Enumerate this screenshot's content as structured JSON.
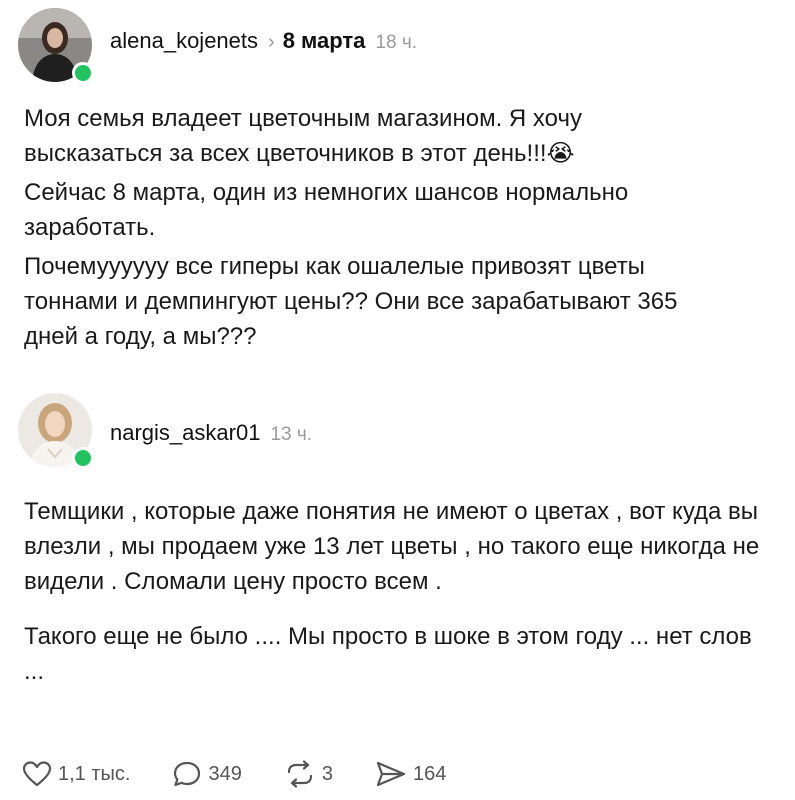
{
  "post": {
    "author": "alena_kojenets",
    "topic": "8 марта",
    "time": "18 ч.",
    "paragraphs": [
      "Моя семья владеет цветочным магазином. Я хочу высказаться за всех цветочников в этот день!!!😭",
      "Сейчас 8 марта, один из немногих шансов нормально заработать.",
      "Почемуууууу все гиперы как ошалелые привозят цветы тоннами и демпингуют цены?? Они все зарабатывают 365 дней а году, а мы???"
    ]
  },
  "reply": {
    "author": "nargis_askar01",
    "time": "13 ч.",
    "paragraphs": [
      "Темщики , которые даже понятия не имеют о цветах , вот куда вы влезли , мы продаем уже 13 лет цветы , но такого еще никогда не видели . Сломали цену просто всем .",
      "Такого еще не было .... Мы просто в шоке в этом году ... нет слов ..."
    ],
    "actions": {
      "likes": "1,1 тыс.",
      "comments": "349",
      "reposts": "3",
      "shares": "164"
    }
  },
  "icons": {
    "like": "heart-icon",
    "comment": "speech-bubble-icon",
    "repost": "repost-icon",
    "share": "send-icon"
  },
  "colors": {
    "online": "#22c35e",
    "muted": "#9a9a9a",
    "text": "#1a1a1a"
  }
}
